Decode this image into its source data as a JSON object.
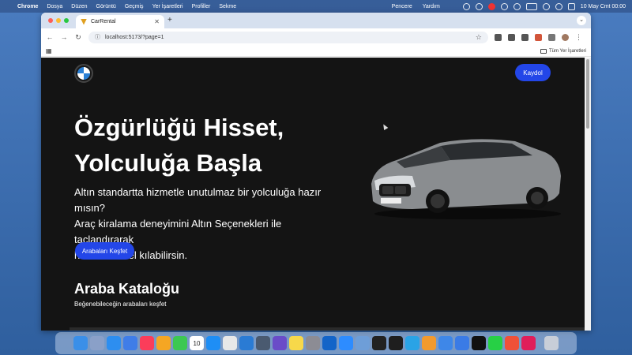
{
  "menubar": {
    "items": [
      "Chrome",
      "Dosya",
      "Düzen",
      "Görüntü",
      "Geçmiş",
      "Yer İşaretleri",
      "Profiller",
      "Sekme"
    ],
    "right_items": [
      "Pencere",
      "Yardım"
    ],
    "clock": "10 May Cmt  00:00"
  },
  "browser": {
    "tab_title": "CarRental",
    "url": "localhost:5173/?page=1",
    "all_bookmarks": "Tüm Yer İşaretleri"
  },
  "page": {
    "signup_label": "Kaydol",
    "hero_title_line1": "Özgürlüğü Hisset,",
    "hero_title_line2": "Yolculuğa Başla",
    "hero_desc_line1": "Altın standartta hizmetle unutulmaz bir yolculuğa hazır mısın?",
    "hero_desc_line2": "Araç kiralama deneyimini Altın Seçenekleri ile taçlandırarak",
    "hero_desc_line3": "her anını özel kılabilirsin.",
    "explore_label": "Arabaları Keşfet",
    "catalog_title": "Araba Kataloğu",
    "catalog_subtitle": "Beğenebileceğin arabaları keşfet"
  },
  "dock": {
    "apps": [
      "finder",
      "launchpad",
      "safari",
      "mail",
      "music",
      "photos",
      "facetime",
      "calendar",
      "app-store",
      "chrome",
      "vscode",
      "screen-recorder",
      "imovie",
      "notes",
      "settings",
      "outlook",
      "zoom",
      "preview",
      "github",
      "terminal",
      "telegram",
      "pages",
      "xcode",
      "keynote",
      "capcut",
      "whatsapp",
      "swift",
      "slack",
      "trash"
    ],
    "colors": [
      "#3a8fe8",
      "#8aa0c8",
      "#2d8ef0",
      "#3f7de8",
      "#fb3d5a",
      "#f5a623",
      "#3cc851",
      "#ffffff",
      "#1e8ef5",
      "#e8e8e8",
      "#2a7bd4",
      "#4a5a70",
      "#6a4cc8",
      "#f7d84a",
      "#8c8c94",
      "#1364c8",
      "#2d8cff",
      "#6e9ed8",
      "#222222",
      "#1e1e1e",
      "#2aa3e6",
      "#f29a2e",
      "#3e87e8",
      "#3a7be6",
      "#111111",
      "#27d045",
      "#f05138",
      "#e01e5a",
      "#c8ced8"
    ],
    "calendar_day": "10"
  }
}
